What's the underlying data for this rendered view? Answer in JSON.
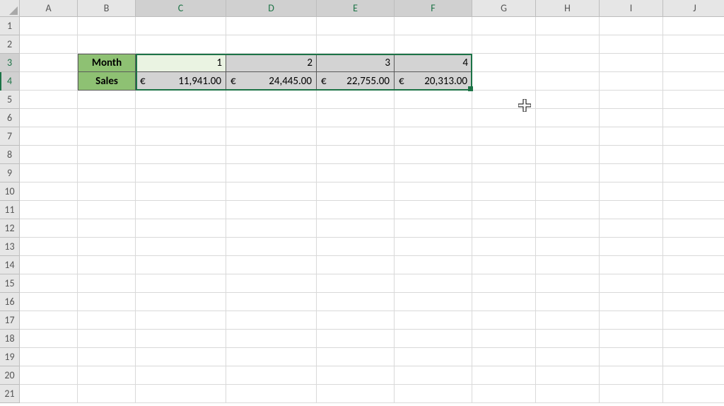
{
  "columns": [
    "A",
    "B",
    "C",
    "D",
    "E",
    "F",
    "G",
    "H",
    "I",
    "J"
  ],
  "rows_count": 21,
  "table": {
    "month_label": "Month",
    "sales_label": "Sales",
    "months": [
      "1",
      "2",
      "3",
      "4"
    ],
    "currency_symbol": "€",
    "sales_values": [
      "11,941.00",
      "24,445.00",
      "22,755.00",
      "20,313.00"
    ]
  },
  "selection": {
    "range": "C3:F4",
    "active_cell": "C3"
  },
  "colors": {
    "header_fill": "#8ec173",
    "selection_border": "#1c7346"
  },
  "chart_data": {
    "type": "table",
    "title": "",
    "categories": [
      "1",
      "2",
      "3",
      "4"
    ],
    "series": [
      {
        "name": "Sales",
        "values": [
          11941.0,
          24445.0,
          22755.0,
          20313.0
        ]
      }
    ],
    "xlabel": "Month",
    "ylabel": "Sales"
  }
}
